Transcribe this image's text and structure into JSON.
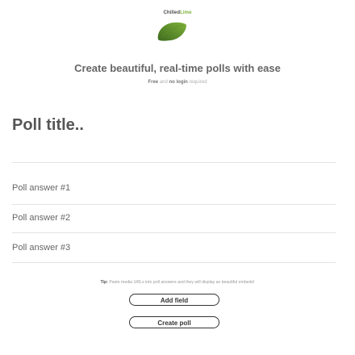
{
  "brand": {
    "name_part1": "Chilled",
    "name_part2": "Lime"
  },
  "colors": {
    "accent": "#7fb23a",
    "accent_dark": "#3d6b1f",
    "text": "#555555",
    "divider": "#e3e3e3",
    "button_border": "#333333"
  },
  "hero": {
    "headline": "Create beautiful, real-time polls with ease",
    "sub_free": "Free",
    "sub_and": " and ",
    "sub_nologin": "no login",
    "sub_required": " required"
  },
  "form": {
    "title_placeholder": "Poll title..",
    "answers": [
      {
        "placeholder": "Poll answer #1"
      },
      {
        "placeholder": "Poll answer #2"
      },
      {
        "placeholder": "Poll answer #3"
      }
    ],
    "tip_label": "Tip:",
    "tip_text": " Paste media URLs into poll answers and they will display as beautiful embeds!",
    "add_field_label": "Add field",
    "create_poll_label": "Create poll"
  }
}
